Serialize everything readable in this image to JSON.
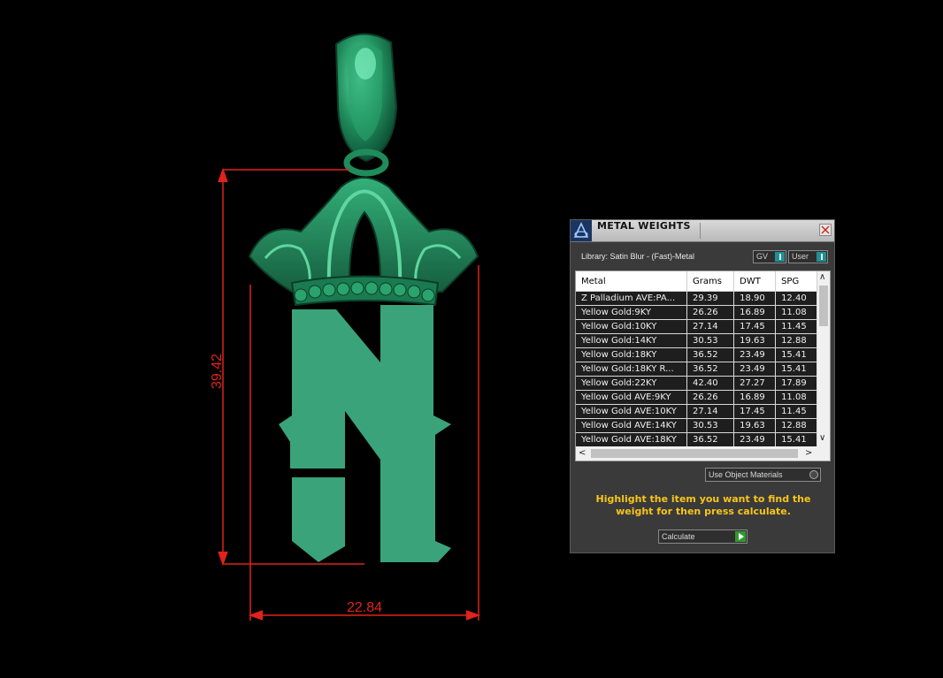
{
  "viewport": {
    "height_dimension": "39.42",
    "width_dimension": "22.84",
    "colors": {
      "background": "#000000",
      "model": "#3aa37a",
      "dimension": "#e0231b"
    }
  },
  "panel": {
    "title": "METAL WEIGHTS",
    "library": "Library: Satin Blur - (Fast)-Metal",
    "toggles": {
      "gv": "GV",
      "user": "User"
    },
    "table": {
      "headers": [
        "Metal",
        "Grams",
        "DWT",
        "SPG"
      ],
      "rows": [
        [
          "Z Palladium AVE:PA...",
          "29.39",
          "18.90",
          "12.40"
        ],
        [
          "Yellow Gold:9KY",
          "26.26",
          "16.89",
          "11.08"
        ],
        [
          "Yellow Gold:10KY",
          "27.14",
          "17.45",
          "11.45"
        ],
        [
          "Yellow Gold:14KY",
          "30.53",
          "19.63",
          "12.88"
        ],
        [
          "Yellow Gold:18KY",
          "36.52",
          "23.49",
          "15.41"
        ],
        [
          "Yellow Gold:18KY R...",
          "36.52",
          "23.49",
          "15.41"
        ],
        [
          "Yellow Gold:22KY",
          "42.40",
          "27.27",
          "17.89"
        ],
        [
          "Yellow Gold AVE:9KY",
          "26.26",
          "16.89",
          "11.08"
        ],
        [
          "Yellow Gold AVE:10KY",
          "27.14",
          "17.45",
          "11.45"
        ],
        [
          "Yellow Gold AVE:14KY",
          "30.53",
          "19.63",
          "12.88"
        ],
        [
          "Yellow Gold AVE:18KY",
          "36.52",
          "23.49",
          "15.41"
        ]
      ]
    },
    "use_object_materials": "Use Object Materials",
    "instructions": "Highlight the item you want to find the weight for then press calculate.",
    "calculate": "Calculate",
    "colors": {
      "background": "#3a3a3a",
      "accent": "#1f8f96",
      "instruction_text": "#f7c51a",
      "calculate_play": "#2f9a2f"
    }
  }
}
